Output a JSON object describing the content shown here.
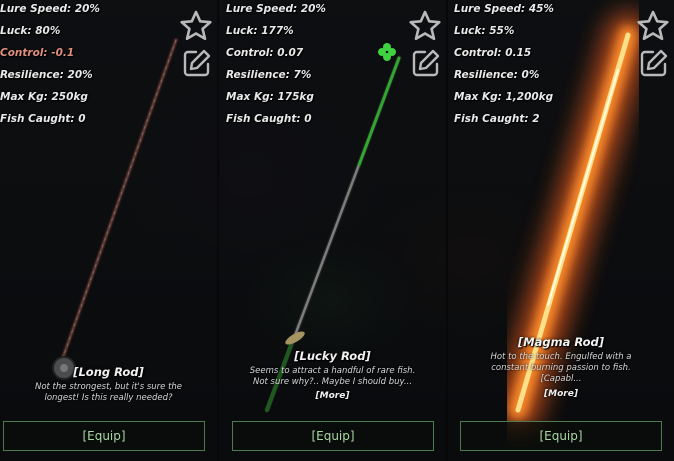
{
  "rods": [
    {
      "name": "[Long Rod]",
      "stats": [
        {
          "label": "Lure Speed: 20%",
          "negative": false
        },
        {
          "label": "Luck: 80%",
          "negative": false
        },
        {
          "label": "Control: -0.1",
          "negative": true
        },
        {
          "label": "Resilience: 20%",
          "negative": false
        },
        {
          "label": "Max Kg: 250kg",
          "negative": false
        },
        {
          "label": "Fish Caught: 0",
          "negative": false
        }
      ],
      "description_lines": [
        "Not the strongest, but it's sure the",
        "longest! Is this really needed?"
      ],
      "more_label": "",
      "equip_label": "[Equip]"
    },
    {
      "name": "[Lucky Rod]",
      "stats": [
        {
          "label": "Lure Speed: 20%",
          "negative": false
        },
        {
          "label": "Luck: 177%",
          "negative": false
        },
        {
          "label": "Control: 0.07",
          "negative": false
        },
        {
          "label": "Resilience: 7%",
          "negative": false
        },
        {
          "label": "Max Kg: 175kg",
          "negative": false
        },
        {
          "label": "Fish Caught: 0",
          "negative": false
        }
      ],
      "description_lines": [
        "Seems to attract a handful of rare fish.",
        "Not sure why?.. Maybe I should buy..."
      ],
      "more_label": "[More]",
      "equip_label": "[Equip]"
    },
    {
      "name": "[Magma Rod]",
      "stats": [
        {
          "label": "Lure Speed: 45%",
          "negative": false
        },
        {
          "label": "Luck: 55%",
          "negative": false
        },
        {
          "label": "Control: 0.15",
          "negative": false
        },
        {
          "label": "Resilience: 0%",
          "negative": false
        },
        {
          "label": "Max Kg: 1,200kg",
          "negative": false
        },
        {
          "label": "Fish Caught: 2",
          "negative": false
        }
      ],
      "description_lines": [
        "Hot to the touch. Engulfed with a",
        "constant burning passion to fish.",
        "[Capabl..."
      ],
      "more_label": "[More]",
      "equip_label": "[Equip]"
    }
  ],
  "icons": {
    "favorite": "star-outline-icon",
    "rename": "edit-pencil-icon"
  },
  "colors": {
    "equip_border": "#4f7a4f",
    "equip_text": "#a9d9a3",
    "negative_stat": "#e08f7d"
  }
}
